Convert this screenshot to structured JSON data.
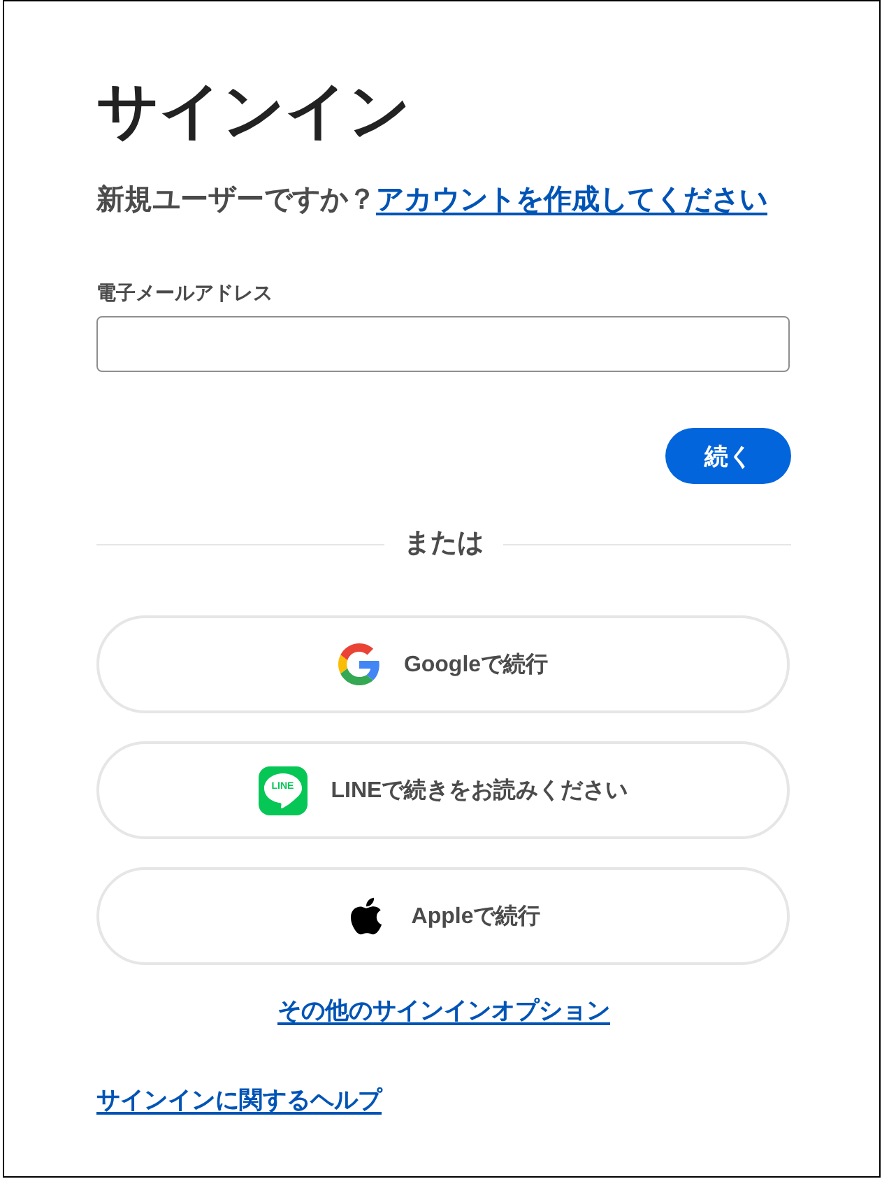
{
  "title": "サインイン",
  "signup_prompt": {
    "text": "新規ユーザーですか？",
    "link": "アカウントを作成してください"
  },
  "email_field": {
    "label": "電子メールアドレス"
  },
  "continue_button": {
    "label": "続く"
  },
  "divider": {
    "label": "または"
  },
  "social_buttons": [
    {
      "kind": "google",
      "label": "Googleで続行"
    },
    {
      "kind": "line",
      "label": "LINEで続きをお読みください",
      "logo_text": "LINE"
    },
    {
      "kind": "apple",
      "label": "Appleで続行"
    }
  ],
  "other_options_link": "その他のサインインオプション",
  "help_link": "サインインに関するヘルプ"
}
